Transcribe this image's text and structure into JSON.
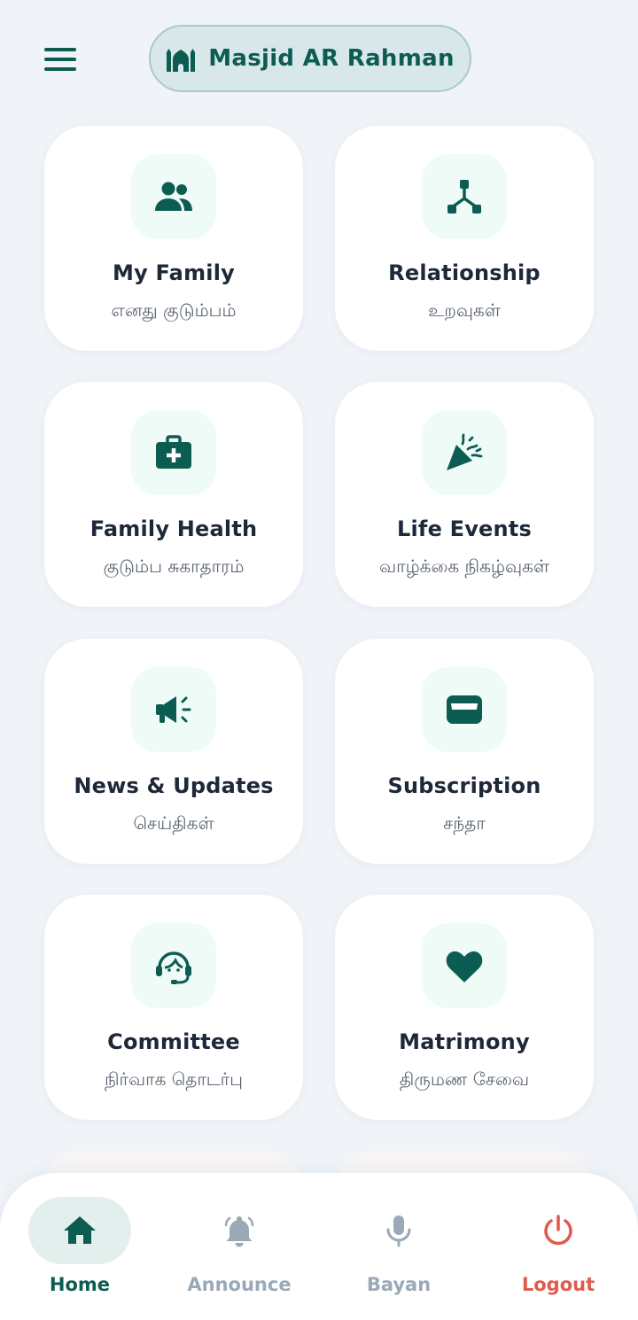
{
  "header": {
    "masjid_name": "Masjid AR Rahman"
  },
  "cards": [
    {
      "title": "My Family",
      "subtitle": "எனது குடும்பம்",
      "icon": "users-icon"
    },
    {
      "title": "Relationship",
      "subtitle": "உறவுகள்",
      "icon": "network-icon"
    },
    {
      "title": "Family Health",
      "subtitle": "குடும்ப சுகாதாரம்",
      "icon": "medical-kit-icon"
    },
    {
      "title": "Life Events",
      "subtitle": "வாழ்க்கை நிகழ்வுகள்",
      "icon": "party-popper-icon"
    },
    {
      "title": "News & Updates",
      "subtitle": "செய்திகள்",
      "icon": "megaphone-icon"
    },
    {
      "title": "Subscription",
      "subtitle": "சந்தா",
      "icon": "wallet-icon"
    },
    {
      "title": "Committee",
      "subtitle": "நிர்வாக தொடர்பு",
      "icon": "headset-icon"
    },
    {
      "title": "Matrimony",
      "subtitle": "திருமண சேவை",
      "icon": "heart-icon"
    }
  ],
  "bottom_nav": [
    {
      "label": "Home",
      "icon": "home-icon",
      "active": true
    },
    {
      "label": "Announce",
      "icon": "bell-icon",
      "active": false
    },
    {
      "label": "Bayan",
      "icon": "microphone-icon",
      "active": false
    },
    {
      "label": "Logout",
      "icon": "power-icon",
      "active": false
    }
  ],
  "colors": {
    "primary": "#0d5c52",
    "background": "#f0f4f8",
    "icon_tile": "#eefbf7",
    "inactive_nav": "#9aa8b8",
    "logout": "#e05a4e"
  }
}
